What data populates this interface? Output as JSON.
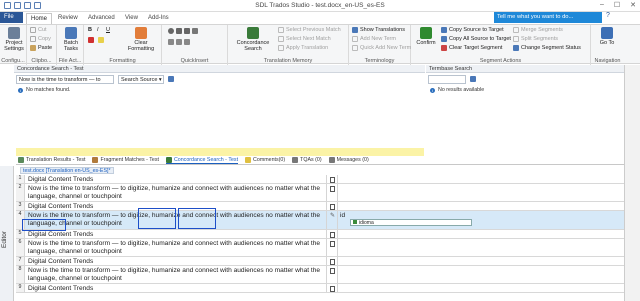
{
  "window": {
    "title": "SDL Trados Studio - test.docx_en-US_es-ES"
  },
  "tabs": {
    "file": "File",
    "home": "Home",
    "review": "Review",
    "advanced": "Advanced",
    "view": "View",
    "addins": "Add-Ins",
    "help": "Help"
  },
  "tell_me": "Tell me what you want to do...",
  "ribbon": {
    "configuration": {
      "project_settings": "Project Settings",
      "label": "Configu..."
    },
    "clipboard": {
      "cut": "Cut",
      "copy": "Copy",
      "paste": "Paste",
      "label": "Clipbo..."
    },
    "file_actions": {
      "batch_tasks": "Batch Tasks",
      "label": "File Act..."
    },
    "formatting": {
      "bold": "B",
      "italic": "I",
      "underline": "U",
      "clear_formatting": "Clear Formatting",
      "label": "Formatting"
    },
    "quickinsert": {
      "label": "QuickInsert"
    },
    "translation_memory": {
      "concordance_search": "Concordance Search",
      "select_previous_match": "Select Previous Match",
      "select_next_match": "Select Next Match",
      "apply_translation": "Apply Translation",
      "label": "Translation Memory"
    },
    "terminology": {
      "show_translations": "Show Translations",
      "add_new_term": "Add New Term",
      "quick_add_new_term": "Quick Add New Term",
      "label": "Terminology"
    },
    "segment_actions": {
      "confirm": "Confirm",
      "copy_source_to_target": "Copy Source to Target",
      "copy_all_source_to_target": "Copy All Source to Target",
      "clear_target_segment": "Clear Target Segment",
      "merge_segments": "Merge Segments",
      "split_segments": "Split Segments",
      "change_segment_status": "Change Segment Status",
      "label": "Segment Actions"
    },
    "navigation": {
      "go_to": "Go To",
      "label": "Navigation"
    }
  },
  "concordance_panel": {
    "header": "Concordance Search - Test",
    "query": "Now is the time to transform — to",
    "mode": "Search Source",
    "message": "No matches found."
  },
  "termbase_panel": {
    "header": "Termbase Search",
    "message": "No results available"
  },
  "bottom_tabs": [
    "Translation Results - Test",
    "Fragment Matches - Test",
    "Concordance Search - Test",
    "Comments(0)",
    "TQAs (0)",
    "Messages (0)"
  ],
  "editor": {
    "label": "Editor",
    "document_tab": "test.docx [Translation en-US_es-ES]*",
    "rows": [
      {
        "num": "1",
        "source": "Digital Content Trends",
        "target": ""
      },
      {
        "num": "2",
        "source": "Now is the time to transform — to digitize, humanize and connect with audiences no matter what the language, channel or touchpoint",
        "target": ""
      },
      {
        "num": "3",
        "source": "Digital Content Trends",
        "target": ""
      },
      {
        "num": "4",
        "source": "Now is the time to transform — to digitize, humanize and connect with audiences no matter what the language, channel or touchpoint",
        "target": "id"
      },
      {
        "num": "5",
        "source": "Digital Content Trends",
        "target": ""
      },
      {
        "num": "6",
        "source": "Now is the time to transform — to digitize, humanize and connect with audiences no matter what the language, channel or touchpoint",
        "target": ""
      },
      {
        "num": "7",
        "source": "Digital Content Trends",
        "target": ""
      },
      {
        "num": "8",
        "source": "Now is the time to transform — to digitize, humanize and connect with audiences no matter what the language, channel or touchpoint",
        "target": ""
      },
      {
        "num": "9",
        "source": "Digital Content Trends",
        "target": ""
      }
    ],
    "autosuggest": "idioma"
  },
  "colors": {
    "accent": "#2b5797",
    "tell_me": "#1e88d8",
    "active_row": "#d6e9f8",
    "highlight_box": "#1e4fc8"
  }
}
